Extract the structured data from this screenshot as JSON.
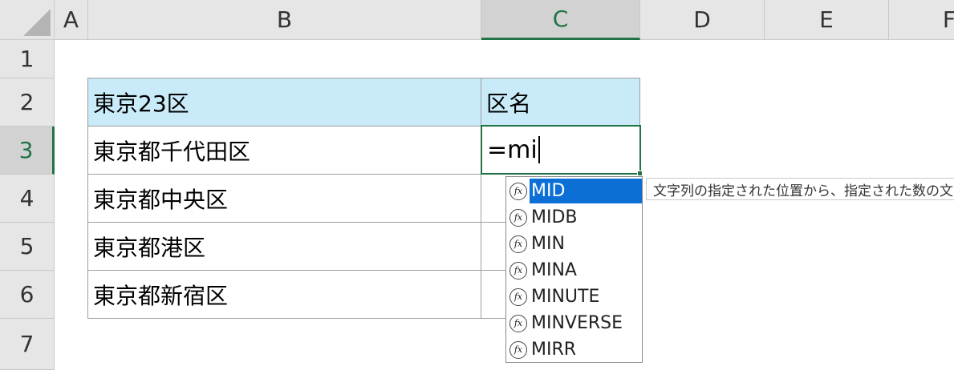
{
  "columns": [
    "A",
    "B",
    "C",
    "D",
    "E",
    "F"
  ],
  "rows": [
    "1",
    "2",
    "3",
    "4",
    "5",
    "6",
    "7"
  ],
  "table": {
    "header": [
      "東京23区",
      "区名"
    ],
    "body": [
      "東京都千代田区",
      "東京都中央区",
      "東京都港区",
      "東京都新宿区"
    ]
  },
  "active_cell": {
    "value": "=mi"
  },
  "autocomplete": {
    "icon": "function-fx-icon",
    "icon_glyph": "fx",
    "items": [
      "MID",
      "MIDB",
      "MIN",
      "MINA",
      "MINUTE",
      "MINVERSE",
      "MIRR"
    ],
    "selected": "MID"
  },
  "tooltip": "文字列の指定された位置から、指定された数の文字を",
  "colors": {
    "header_fill": "#c9ebf9",
    "selection": "#217346",
    "highlight": "#0b6fd6"
  }
}
